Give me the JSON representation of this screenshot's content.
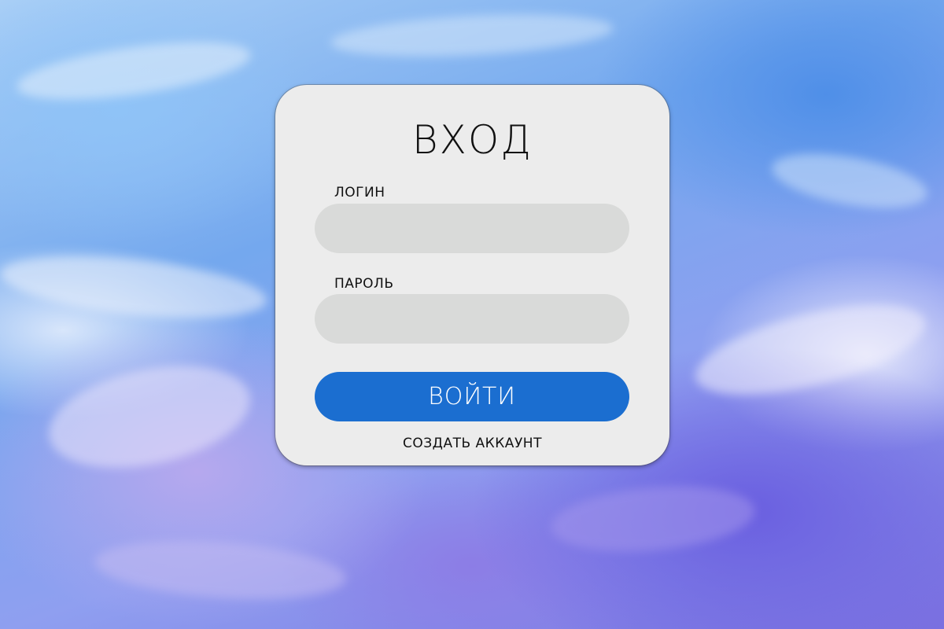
{
  "login_form": {
    "title": "ВХОД",
    "login_label": "ЛОГИН",
    "login_value": "",
    "password_label": "ПАРОЛЬ",
    "password_value": "",
    "submit_label": "ВОЙТИ",
    "create_account_label": "СОЗДАТЬ АККАУНТ"
  },
  "colors": {
    "card_background": "#ececec",
    "field_background": "#d9dad9",
    "button_background": "#1b6ed0",
    "button_text": "#ffffff"
  }
}
